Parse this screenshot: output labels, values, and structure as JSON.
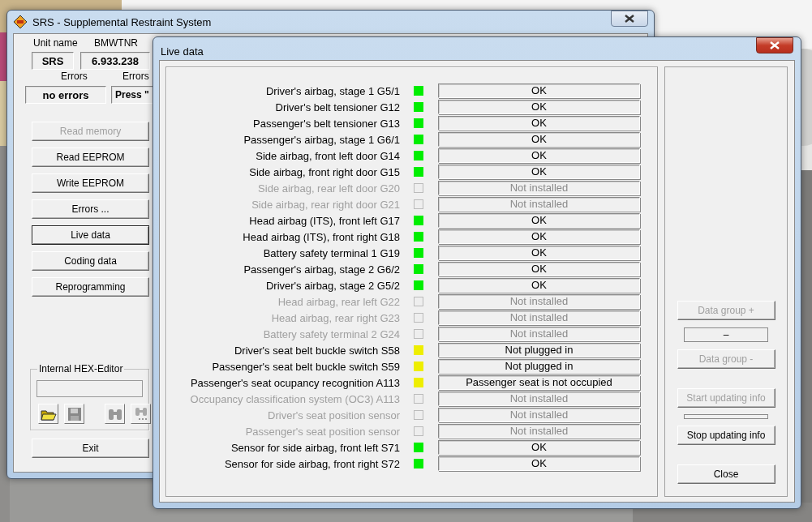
{
  "main_window": {
    "title": "SRS - Supplemental Restraint System",
    "unit_name_label": "Unit name",
    "unit_name": "SRS",
    "variant_label": "BMWTNR",
    "variant": "6.933.238",
    "errors_label": "Errors",
    "errors_value": "no errors",
    "errors_label_2": "Errors",
    "errors_value_2": "Press \"",
    "buttons": [
      {
        "label": "Read memory",
        "disabled": true,
        "focused": false
      },
      {
        "label": "Read EEPROM",
        "disabled": false,
        "focused": false
      },
      {
        "label": "Write EEPROM",
        "disabled": false,
        "focused": false
      },
      {
        "label": "Errors ...",
        "disabled": false,
        "focused": false
      },
      {
        "label": "Live data",
        "disabled": false,
        "focused": true
      },
      {
        "label": "Coding data",
        "disabled": false,
        "focused": false
      },
      {
        "label": "Reprogramming",
        "disabled": false,
        "focused": false
      }
    ],
    "hex_editor": {
      "title": "Internal HEX-Editor"
    },
    "exit_button": "Exit"
  },
  "live_window": {
    "title": "Live data",
    "rows": [
      {
        "label": "Driver's airbag, stage 1 G5/1",
        "disabled": false,
        "color": "#00ee00",
        "value": "OK"
      },
      {
        "label": "Driver's belt tensioner G12",
        "disabled": false,
        "color": "#00ee00",
        "value": "OK"
      },
      {
        "label": "Passenger's belt tensioner G13",
        "disabled": false,
        "color": "#00ee00",
        "value": "OK"
      },
      {
        "label": "Passenger's airbag, stage 1 G6/1",
        "disabled": false,
        "color": "#00ee00",
        "value": "OK"
      },
      {
        "label": "Side airbag, front left door G14",
        "disabled": false,
        "color": "#00ee00",
        "value": "OK"
      },
      {
        "label": "Side airbag, front right door G15",
        "disabled": false,
        "color": "#00ee00",
        "value": "OK"
      },
      {
        "label": "Side airbag, rear left door G20",
        "disabled": true,
        "value": "Not installed"
      },
      {
        "label": "Side airbag, rear right door G21",
        "disabled": true,
        "value": "Not installed"
      },
      {
        "label": "Head airbag (ITS), front left G17",
        "disabled": false,
        "color": "#00ee00",
        "value": "OK"
      },
      {
        "label": "Head airbag (ITS), front right G18",
        "disabled": false,
        "color": "#00ee00",
        "value": "OK"
      },
      {
        "label": "Battery safety terminal 1 G19",
        "disabled": false,
        "color": "#00ee00",
        "value": "OK"
      },
      {
        "label": "Passenger's airbag, stage 2 G6/2",
        "disabled": false,
        "color": "#00ee00",
        "value": "OK"
      },
      {
        "label": "Driver's airbag, stage 2 G5/2",
        "disabled": false,
        "color": "#00ee00",
        "value": "OK"
      },
      {
        "label": "Head airbag, rear left G22",
        "disabled": true,
        "value": "Not installed"
      },
      {
        "label": "Head airbag, rear right G23",
        "disabled": true,
        "value": "Not installed"
      },
      {
        "label": "Battery safety terminal 2 G24",
        "disabled": true,
        "value": "Not installed"
      },
      {
        "label": "Driver's seat belt buckle switch S58",
        "disabled": false,
        "color": "#eeee00",
        "value": "Not plugged in"
      },
      {
        "label": "Passenger's seat belt buckle switch S59",
        "disabled": false,
        "color": "#eeee00",
        "value": "Not plugged in"
      },
      {
        "label": "Passenger's seat ocupancy recognition A113",
        "disabled": false,
        "color": "#eeee00",
        "value": "Passenger seat is not occupied"
      },
      {
        "label": "Occupancy classification system (OC3) A113",
        "disabled": true,
        "value": "Not installed"
      },
      {
        "label": "Driver's seat position sensor",
        "disabled": true,
        "value": "Not installed"
      },
      {
        "label": "Passenger's seat position sensor",
        "disabled": true,
        "value": "Not installed"
      },
      {
        "label": "Sensor for side airbag, front left S71",
        "disabled": false,
        "color": "#00ee00",
        "value": "OK"
      },
      {
        "label": "Sensor for side airbag, front right S72",
        "disabled": false,
        "color": "#00ee00",
        "value": "OK"
      }
    ],
    "data_group_plus": {
      "label": "Data group +",
      "disabled": true
    },
    "data_group_value": "–",
    "data_group_minus": {
      "label": "Data group -",
      "disabled": true
    },
    "progress": {
      "level": 0
    },
    "start_updating": {
      "label": "Start updating info",
      "disabled": true
    },
    "stop_updating": {
      "label": "Stop updating info",
      "disabled": false
    },
    "close_button": "Close"
  }
}
